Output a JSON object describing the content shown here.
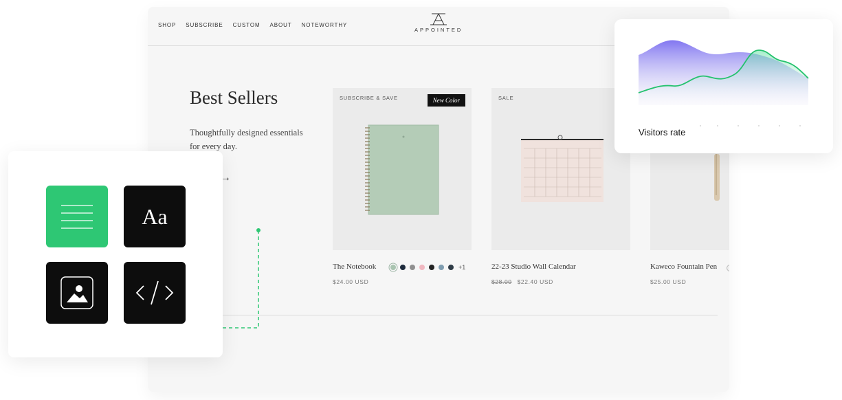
{
  "nav": {
    "links": [
      "SHOP",
      "SUBSCRIBE",
      "CUSTOM",
      "ABOUT",
      "NOTEWORTHY"
    ],
    "logo_text": "APPOINTED"
  },
  "hero": {
    "title": "Best Sellers",
    "subtitle": "Thoughtfully designed essentials for every day.",
    "arrow": "→"
  },
  "products": [
    {
      "badge": "SUBSCRIBE & SAVE",
      "tag": "New Color",
      "name": "The Notebook",
      "price": "$24.00 USD",
      "swatches": [
        "#a9c4b0",
        "#1d2a3b",
        "#8f8f8f",
        "#f0b7c0",
        "#222222",
        "#7f9db0",
        "#2f3b46"
      ],
      "swatch_more": "+1"
    },
    {
      "badge": "SALE",
      "name": "22-23 Studio Wall Calendar",
      "old_price": "$28.00",
      "price": "$22.40 USD"
    },
    {
      "name": "Kaweco Fountain Pen",
      "price": "$25.00 USD"
    }
  ],
  "blocks": {
    "items": [
      "text-block-icon",
      "typography-block",
      "image-block-icon",
      "code-block-icon"
    ],
    "typography_label": "Aa"
  },
  "stats": {
    "label": "Visitors rate"
  },
  "colors": {
    "accent_green": "#2ec774",
    "area_purple": "#7b6ff0",
    "line_green": "#25c26e",
    "page_bg": "#f6f6f6"
  }
}
